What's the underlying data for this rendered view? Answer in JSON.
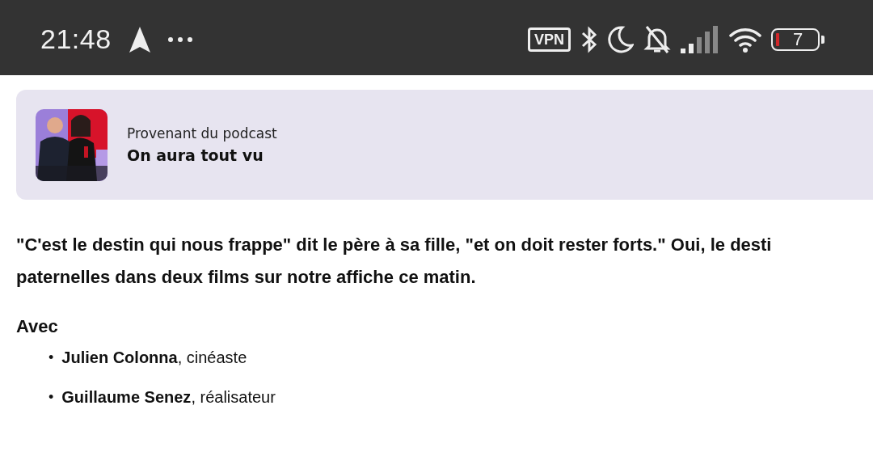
{
  "status_bar": {
    "time": "21:48",
    "vpn": "VPN",
    "battery": "7"
  },
  "podcast_card": {
    "caption": "Provenant du podcast",
    "title": "On aura tout vu"
  },
  "description": "\"C'est le destin qui nous frappe\" dit le père à sa fille, \"et on doit rester forts.\" Oui, le desti\npaternelles dans deux films sur notre affiche ce matin.",
  "guests": {
    "heading": "Avec",
    "items": [
      {
        "bullet": "•",
        "text": "**Julien Colonna**, cinéaste"
      },
      {
        "bullet": "•",
        "text": "**Guillaume Senez**, réalisateur"
      }
    ]
  }
}
